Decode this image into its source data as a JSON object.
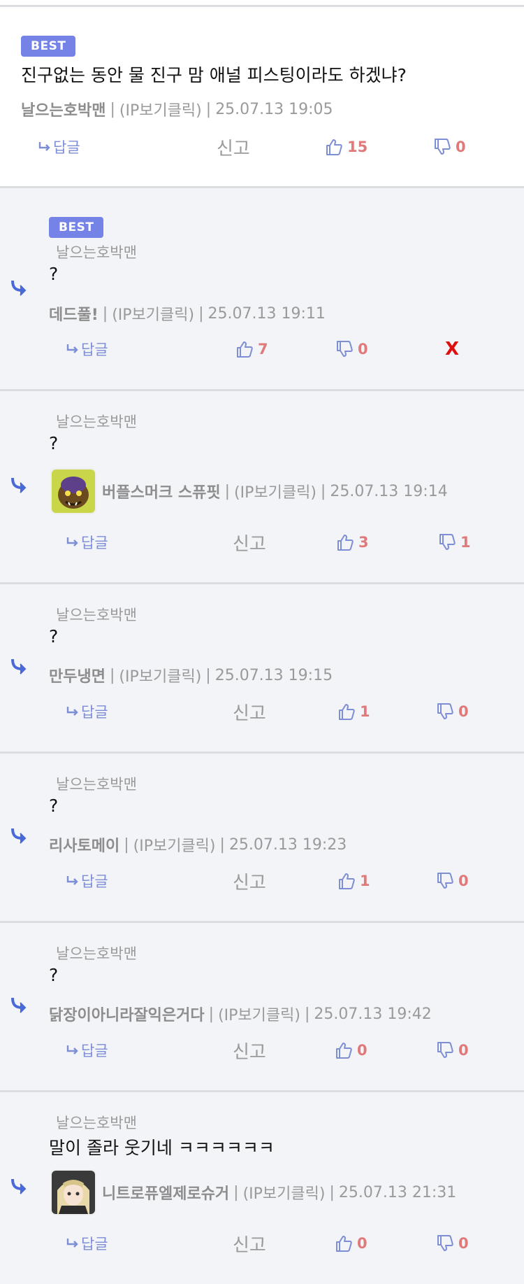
{
  "labels": {
    "best": "BEST",
    "reply": "답글",
    "report": "신고",
    "delete": "X",
    "ip": "(IP보기클릭)",
    "sep": "|"
  },
  "colors": {
    "best_bg": "#7583e6",
    "reply_link": "#7d8ed4",
    "count": "#e07a7a",
    "delete": "#d11111"
  },
  "comments": [
    {
      "best": true,
      "text": "진구없는 동안 물 진구 맘 애널 피스팅이라도 하겠냐?",
      "nick": "날으는호박맨",
      "date": "25.07.13 19:05",
      "likes": "15",
      "dislikes": "0"
    },
    {
      "best": true,
      "parent": "날으는호박맨",
      "text": "?",
      "nick": "데드풀!",
      "date": "25.07.13 19:11",
      "likes": "7",
      "dislikes": "0"
    },
    {
      "parent": "날으는호박맨",
      "text": "?",
      "nick": "버플스머크 스퓨핏",
      "avatar": "goblin-avatar",
      "date": "25.07.13 19:14",
      "likes": "3",
      "dislikes": "1"
    },
    {
      "parent": "날으는호박맨",
      "text": "?",
      "nick": "만두냉면",
      "date": "25.07.13 19:15",
      "likes": "1",
      "dislikes": "0"
    },
    {
      "parent": "날으는호박맨",
      "text": "?",
      "nick": "리사토메이",
      "date": "25.07.13 19:23",
      "likes": "1",
      "dislikes": "0"
    },
    {
      "parent": "날으는호박맨",
      "text": "?",
      "nick": "닭장이아니라잘익은거다",
      "date": "25.07.13 19:42",
      "likes": "0",
      "dislikes": "0"
    },
    {
      "parent": "날으는호박맨",
      "text": "말이 졸라 웃기네 ㅋㅋㅋㅋㅋㅋ",
      "nick": "니트로퓨엘제로슈거",
      "avatar": "anime-girl-avatar",
      "date": "25.07.13 21:31",
      "likes": "0",
      "dislikes": "0"
    }
  ]
}
